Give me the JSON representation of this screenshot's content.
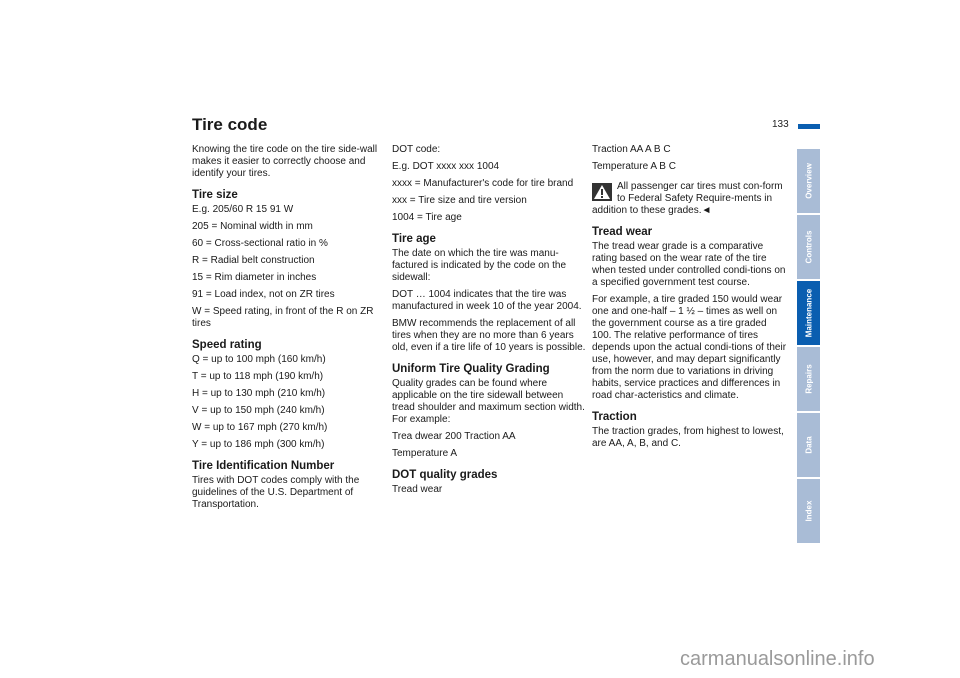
{
  "page": {
    "title": "Tire code",
    "page_number": "133",
    "accent_color": "#0a5eb0",
    "tab_color": "#a9bcd6"
  },
  "col1": {
    "intro": "Knowing the tire code on the tire side-wall makes it easier to correctly choose and identify your tires.",
    "tire_size_heading": "Tire size",
    "tire_size_lines": [
      "E.g. 205/60 R 15 91 W",
      "205 = Nominal width in mm",
      "60 = Cross-sectional ratio in %",
      "R = Radial belt construction",
      "15 = Rim diameter in inches",
      "91 = Load index, not on ZR tires",
      "W = Speed rating, in front of the R on ZR tires"
    ],
    "speed_heading": "Speed rating",
    "speed_lines": [
      "Q = up to 100 mph (160 km/h)",
      "T = up to 118 mph (190 km/h)",
      "H = up to 130 mph (210 km/h)",
      "V = up to 150 mph (240 km/h)",
      "W = up to 167 mph (270 km/h)",
      "Y = up to 186 mph (300 km/h)"
    ],
    "tin_heading": "Tire Identification Number",
    "tin_text": "Tires with DOT codes comply with the guidelines of the U.S. Department of Transportation."
  },
  "col2": {
    "dot_lines": [
      "DOT code:",
      "E.g. DOT xxxx xxx 1004",
      "xxxx = Manufacturer's code for tire brand",
      "xxx = Tire size and tire version",
      "1004 = Tire age"
    ],
    "age_heading": "Tire age",
    "age_paragraphs": [
      "The date on which the tire was manu-factured is indicated by the code on the sidewall:",
      "DOT … 1004 indicates that the tire was manufactured in week 10 of the year 2004.",
      "BMW recommends the replacement of all tires when they are no more than 6 years old, even if a tire life of 10 years is possible."
    ],
    "utqg_heading": "Uniform Tire Quality Grading",
    "utqg_paragraphs": [
      "Quality grades can be found where applicable on the tire sidewall between tread shoulder and maximum section width. For example:",
      "Trea dwear 200 Traction AA",
      "Temperature A"
    ],
    "dot_grades_heading": "DOT quality grades",
    "dot_grades_text": "Tread wear"
  },
  "col3": {
    "lines": [
      "Traction AA A B C",
      "Temperature A B C"
    ],
    "warning_text": "All passenger car tires must con-form to Federal Safety Require-ments in addition to these grades.◄",
    "tread_heading": "Tread wear",
    "tread_paragraphs": [
      "The tread wear grade is a comparative rating based on the wear rate of the tire when tested under controlled condi-tions on a specified government test course.",
      "For example, a tire graded 150 would wear one and one-half – 1 ½ – times as well on the government course as a tire graded 100. The relative performance of tires depends upon the actual condi-tions of their use, however, and may depart significantly from the norm due to variations in driving habits, service practices and differences in road char-acteristics and climate."
    ],
    "traction_heading": "Traction",
    "traction_text": "The traction grades, from highest to lowest, are AA, A, B, and C."
  },
  "tabs": [
    {
      "label": "Overview",
      "active": false
    },
    {
      "label": "Controls",
      "active": false
    },
    {
      "label": "Maintenance",
      "active": true
    },
    {
      "label": "Repairs",
      "active": false
    },
    {
      "label": "Data",
      "active": false
    },
    {
      "label": "Index",
      "active": false
    }
  ],
  "watermark": "carmanualsonline.info"
}
